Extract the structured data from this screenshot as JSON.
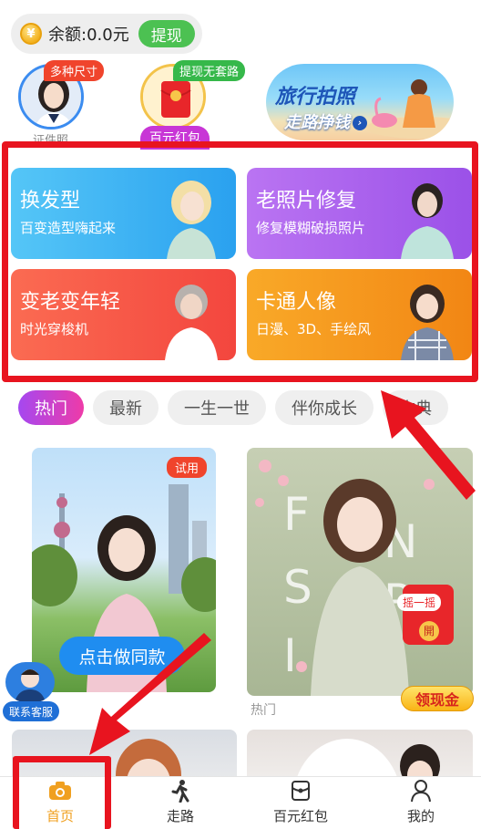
{
  "header": {
    "balance": "余额:0.0元",
    "withdraw": "提现",
    "coin_glyph": "¥"
  },
  "shortcuts": {
    "idphoto": {
      "tag": "多种尺寸",
      "label": "证件照"
    },
    "hongbao": {
      "tag": "提现无套路",
      "label": "百元红包"
    },
    "travel": {
      "title": "旅行拍照",
      "subtitle": "走路挣钱"
    }
  },
  "feature_cards": [
    {
      "title": "换发型",
      "subtitle": "百变造型嗨起来"
    },
    {
      "title": "老照片修复",
      "subtitle": "修复模糊破损照片"
    },
    {
      "title": "变老变年轻",
      "subtitle": "时光穿梭机"
    },
    {
      "title": "卡通人像",
      "subtitle": "日漫、3D、手绘风"
    }
  ],
  "tabs": [
    "热门",
    "最新",
    "一生一世",
    "伴你成长",
    "古典"
  ],
  "templates": {
    "trial_badge": "试用",
    "same_style_button": "点击做同款",
    "hot_caption": "热门",
    "hongbao_float_text": "摇一摇",
    "hongbao_open": "開",
    "collect_cash": "领现金",
    "tile2_letters": "FNSPIC"
  },
  "service": {
    "label": "联系客服"
  },
  "bottom_nav": [
    {
      "label": "首页",
      "icon": "camera-icon",
      "active": true
    },
    {
      "label": "走路",
      "icon": "walking-icon",
      "active": false
    },
    {
      "label": "百元红包",
      "icon": "red-envelope-icon",
      "active": false
    },
    {
      "label": "我的",
      "icon": "profile-icon",
      "active": false
    }
  ],
  "colors": {
    "accent_red": "#e8141f",
    "green": "#4cc152",
    "active_nav": "#f0a020"
  }
}
